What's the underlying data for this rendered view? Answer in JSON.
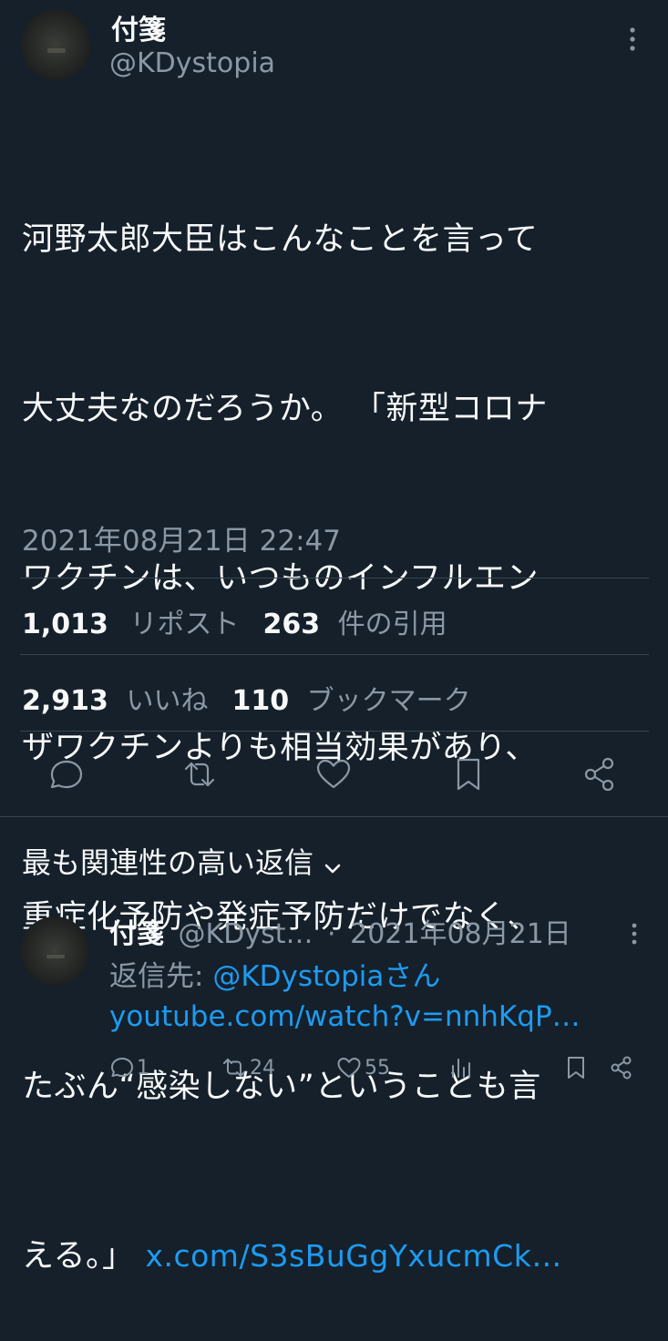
{
  "tweet": {
    "author_name": "付箋",
    "author_handle": "@KDystopia",
    "text_lines": [
      "河野太郎大臣はこんなことを言って",
      "大丈夫なのだろうか。 「新型コロナ",
      "ワクチンは、いつものインフルエン",
      "ザワクチンよりも相当効果があり、",
      "重症化予防や発症予防だけでなく、",
      "たぶん“感染しない”ということも言"
    ],
    "text_last": "える。」",
    "link": "x.com/S3sBuGgYxucmCk…",
    "datetime": "2021年08月21日 22:47",
    "reposts": "1,013",
    "reposts_label": "リポスト",
    "quotes": "263",
    "quotes_label": "件の引用",
    "likes": "2,913",
    "likes_label": "いいね",
    "bookmarks": "110",
    "bookmarks_label": "ブックマーク"
  },
  "replies_section": {
    "title": "最も関連性の高い返信"
  },
  "reply": {
    "author_name": "付箋",
    "author_handle": "@KDyst…",
    "separator": "·",
    "date": "2021年08月21日",
    "reply_to_prefix": "返信先: ",
    "reply_to_handle": "@KDystopia",
    "reply_to_suffix": "さん",
    "link": "youtube.com/watch?v=nnhKqP…",
    "replies": "1",
    "reposts": "24",
    "likes": "55"
  },
  "colors": {
    "background": "#15202b",
    "text": "#f7f9f9",
    "secondary": "#8b98a5",
    "link": "#1d9bf0",
    "divider": "#38444d"
  },
  "icons": [
    "more-icon",
    "reply-icon",
    "repost-icon",
    "like-icon",
    "bookmark-icon",
    "share-icon",
    "chevron-down-icon",
    "views-icon"
  ]
}
